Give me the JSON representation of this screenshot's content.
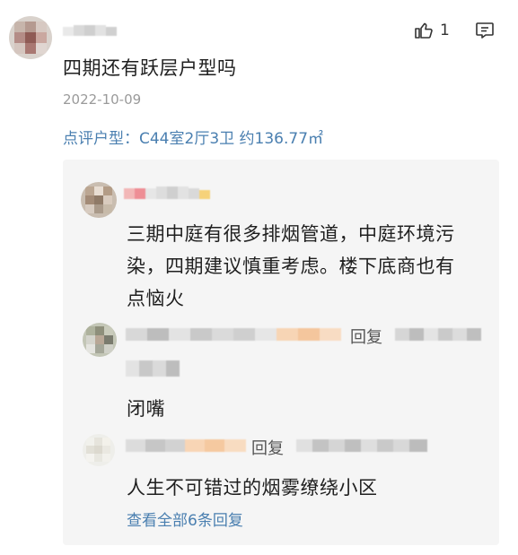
{
  "main_comment": {
    "like_count": "1",
    "text": "四期还有跃层户型吗",
    "date": "2022-10-09",
    "review_tag": "点评户型：",
    "review_value": "C44室2厅3卫 约136.77㎡"
  },
  "replies": {
    "reply1": {
      "text_line1": "三期中庭有很多排烟管道，中庭环境污",
      "text_line2": "染，四期建议慎重考虑。楼下底商也有",
      "text_line3": "点恼火"
    },
    "reply2": {
      "reply_label": "回复",
      "text": "闭嘴"
    },
    "reply3": {
      "reply_label": "回复",
      "text": "人生不可错过的烟雾缭绕小区"
    },
    "view_all": "查看全部6条回复"
  }
}
